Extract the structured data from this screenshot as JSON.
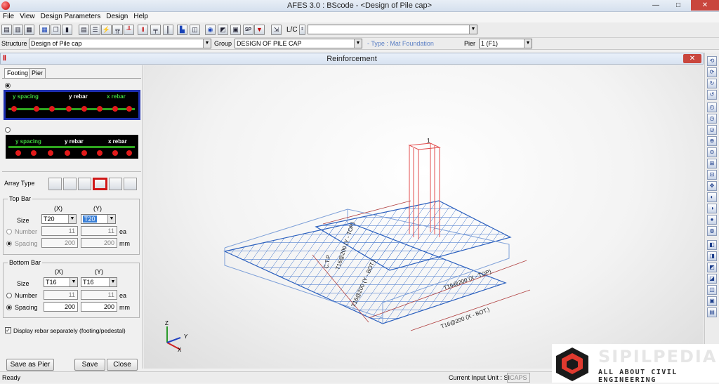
{
  "window": {
    "title": "AFES 3.0 : BScode - <Design of Pile cap>",
    "min": "—",
    "max": "□",
    "close": "✕"
  },
  "menu": [
    "File",
    "View",
    "Design Parameters",
    "Design",
    "Help"
  ],
  "toolbar": {
    "lc_label": "L/C",
    "lc_value": "",
    "sp_label": "SP"
  },
  "structure_bar": {
    "structure_label": "Structure",
    "structure_value": "Design of Pile cap",
    "group_label": "Group",
    "group_value": "DESIGN OF PILE CAP",
    "type_text": "- Type : Mat  Foundation",
    "pier_label": "Pier",
    "pier_value": "1 (F1)"
  },
  "dialog": {
    "title": "Reinforcement",
    "close": "✕"
  },
  "panel": {
    "tabs": [
      "Footing",
      "Pier"
    ],
    "option1": {
      "y_spacing": "y spacing",
      "y_rebar": "y rebar",
      "x_rebar": "x rebar"
    },
    "option2": {
      "y_spacing": "y spacing",
      "y_rebar": "y rebar",
      "x_rebar": "x rebar"
    },
    "array_type_label": "Array Type",
    "top_bar": {
      "title": "Top Bar",
      "col_x": "(X)",
      "col_y": "(Y)",
      "size_label": "Size",
      "size_x": "T20",
      "size_y": "T20",
      "number_label": "Number",
      "number_x": "11",
      "number_y": "11",
      "number_unit": "ea",
      "spacing_label": "Spacing",
      "spacing_x": "200",
      "spacing_y": "200",
      "spacing_unit": "mm"
    },
    "bottom_bar": {
      "title": "Bottom Bar",
      "col_x": "(X)",
      "col_y": "(Y)",
      "size_label": "Size",
      "size_x": "T16",
      "size_y": "T16",
      "number_label": "Number",
      "number_x": "11",
      "number_y": "11",
      "number_unit": "ea",
      "spacing_label": "Spacing",
      "spacing_x": "200",
      "spacing_y": "200",
      "spacing_unit": "mm"
    },
    "display_separately": "Display rebar separately (footing/pedestal)",
    "buttons": {
      "save_as_pier": "Save as Pier",
      "save": "Save",
      "close": "Close"
    }
  },
  "viewport": {
    "pier_number": "1",
    "labels": {
      "top_x": "T16@200 (X - TOP)",
      "top_y": "T16@200 (Y - TOP)",
      "bot_x": "T16@200 (X - BOT.)",
      "bot_y": "T16@200 (Y - BOT.)",
      "side": "C.T.P"
    },
    "axes": {
      "z": "Z",
      "y": "Y",
      "x": "X"
    }
  },
  "status": {
    "ready": "Ready",
    "unit_label": "Current Input Unit : SI",
    "caps": "CAPS"
  },
  "watermark": {
    "brand": "SIPILPEDIA",
    "tagline": "ALL ABOUT CIVIL ENGINEERING"
  }
}
